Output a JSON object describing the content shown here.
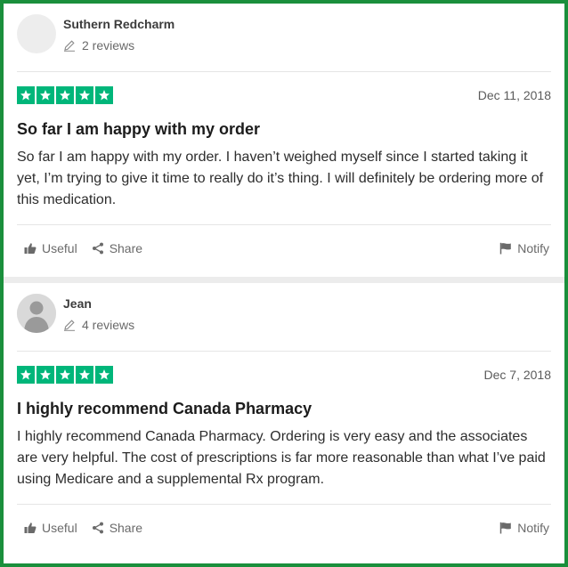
{
  "reviews": [
    {
      "user_name": "Suthern Redcharm",
      "review_count": "2 reviews",
      "date": "Dec 11, 2018",
      "rating": 5,
      "title": "So far I am happy with my order",
      "body": "So far I am happy with my order. I haven’t weighed myself since I started taking it yet, I’m trying to give it time to really do it’s thing. I will definitely be ordering more of this medication."
    },
    {
      "user_name": "Jean",
      "review_count": "4 reviews",
      "date": "Dec 7, 2018",
      "rating": 5,
      "title": "I highly recommend Canada Pharmacy",
      "body": "I highly recommend Canada Pharmacy. Ordering is very easy and the associates are very helpful. The cost of prescriptions is far more reasonable than what I’ve paid using Medicare and a supplemental Rx program."
    }
  ],
  "actions": {
    "useful_label": "Useful",
    "share_label": "Share",
    "notify_label": "Notify"
  },
  "colors": {
    "border": "#1a8f3c",
    "star_bg": "#00b67a",
    "muted_text": "#6a6a6a"
  },
  "icons": [
    "pencil-icon",
    "star-icon",
    "thumbs-up-icon",
    "share-icon",
    "flag-icon",
    "user-silhouette-icon"
  ]
}
